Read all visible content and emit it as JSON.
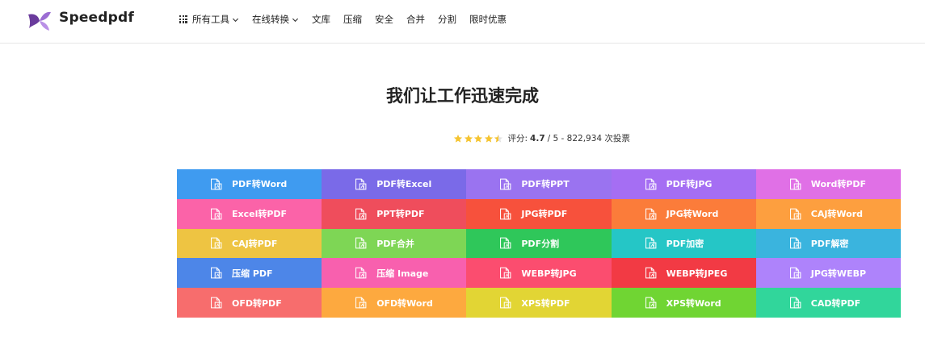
{
  "header": {
    "brand": "Speedpdf",
    "nav": [
      {
        "label": "所有工具",
        "icon": "grid-icon",
        "dropdown": true
      },
      {
        "label": "在线转换",
        "dropdown": true
      },
      {
        "label": "文库"
      },
      {
        "label": "压缩"
      },
      {
        "label": "安全"
      },
      {
        "label": "合并"
      },
      {
        "label": "分割"
      },
      {
        "label": "限时优惠"
      }
    ]
  },
  "hero": {
    "title": "我们让工作迅速完成",
    "rating_label": "评分:",
    "rating_value": "4.7",
    "rating_rest": "/ 5 - 822,934 次投票",
    "stars": 4.5
  },
  "tools": [
    {
      "label": "PDF转Word",
      "color": "#3f9bf0"
    },
    {
      "label": "PDF转Excel",
      "color": "#7a6ae8"
    },
    {
      "label": "PDF转PPT",
      "color": "#9a73f0"
    },
    {
      "label": "PDF转JPG",
      "color": "#a56ef3"
    },
    {
      "label": "Word转PDF",
      "color": "#e070e6"
    },
    {
      "label": "Excel转PDF",
      "color": "#fb63a8"
    },
    {
      "label": "PPT转PDF",
      "color": "#ef4d5c"
    },
    {
      "label": "JPG转PDF",
      "color": "#f7513c"
    },
    {
      "label": "JPG转Word",
      "color": "#fb7c3a"
    },
    {
      "label": "CAJ转Word",
      "color": "#fd9f3f"
    },
    {
      "label": "CAJ转PDF",
      "color": "#eec442"
    },
    {
      "label": "PDF合并",
      "color": "#7ed655"
    },
    {
      "label": "PDF分割",
      "color": "#2fc75a"
    },
    {
      "label": "PDF加密",
      "color": "#25c6c6"
    },
    {
      "label": "PDF解密",
      "color": "#3ab4de"
    },
    {
      "label": "压缩 PDF",
      "color": "#4d86e8"
    },
    {
      "label": "压缩 Image",
      "color": "#f860ae"
    },
    {
      "label": "WEBP转JPG",
      "color": "#fb4d6f"
    },
    {
      "label": "WEBP转JPEG",
      "color": "#f23a44"
    },
    {
      "label": "JPG转WEBP",
      "color": "#ae83fb"
    },
    {
      "label": "OFD转PDF",
      "color": "#f76d6d"
    },
    {
      "label": "OFD转Word",
      "color": "#fda93f"
    },
    {
      "label": "XPS转PDF",
      "color": "#e2d534"
    },
    {
      "label": "XPS转Word",
      "color": "#70d533"
    },
    {
      "label": "CAD转PDF",
      "color": "#31d69b"
    }
  ]
}
